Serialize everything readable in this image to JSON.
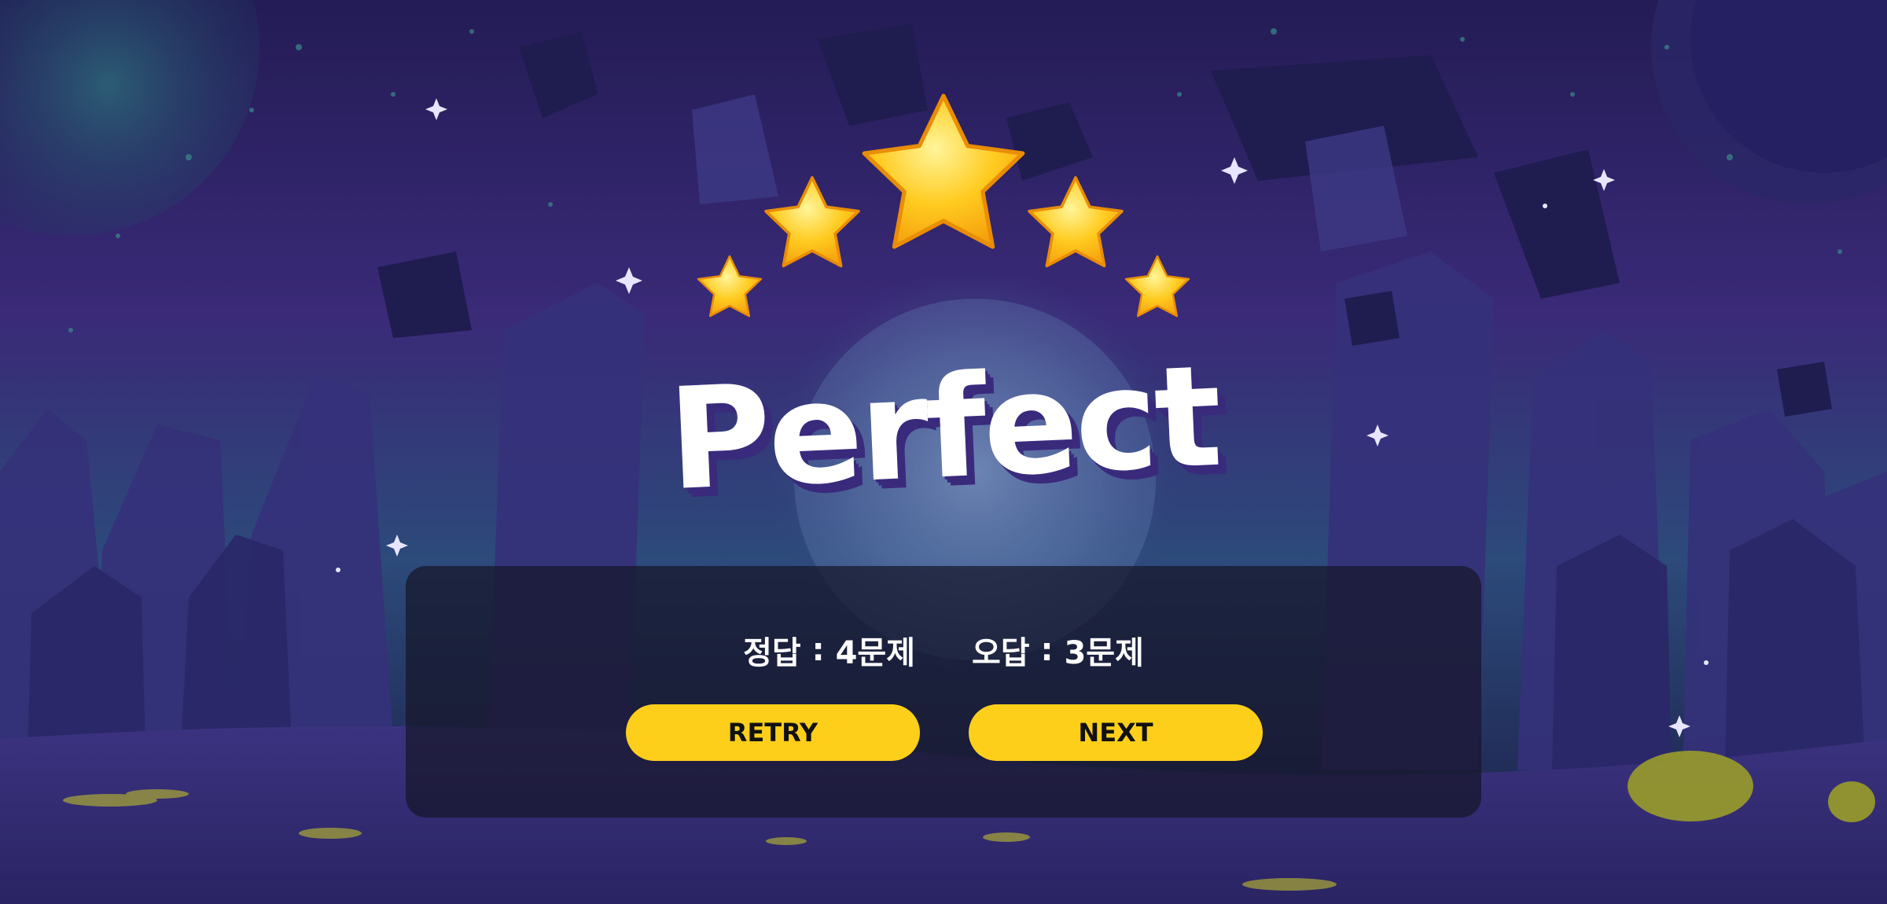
{
  "result": {
    "title": "Perfect",
    "stars_earned": 5,
    "stars_total": 5
  },
  "score": {
    "correct_label": "정답",
    "correct_value": "4문제",
    "wrong_label": "오답",
    "wrong_value": "3문제",
    "separator": " : "
  },
  "buttons": {
    "retry_label": "RETRY",
    "next_label": "NEXT"
  },
  "colors": {
    "button": "#fdcf1a",
    "star": "#ffc21a",
    "panel": "#16162a"
  }
}
